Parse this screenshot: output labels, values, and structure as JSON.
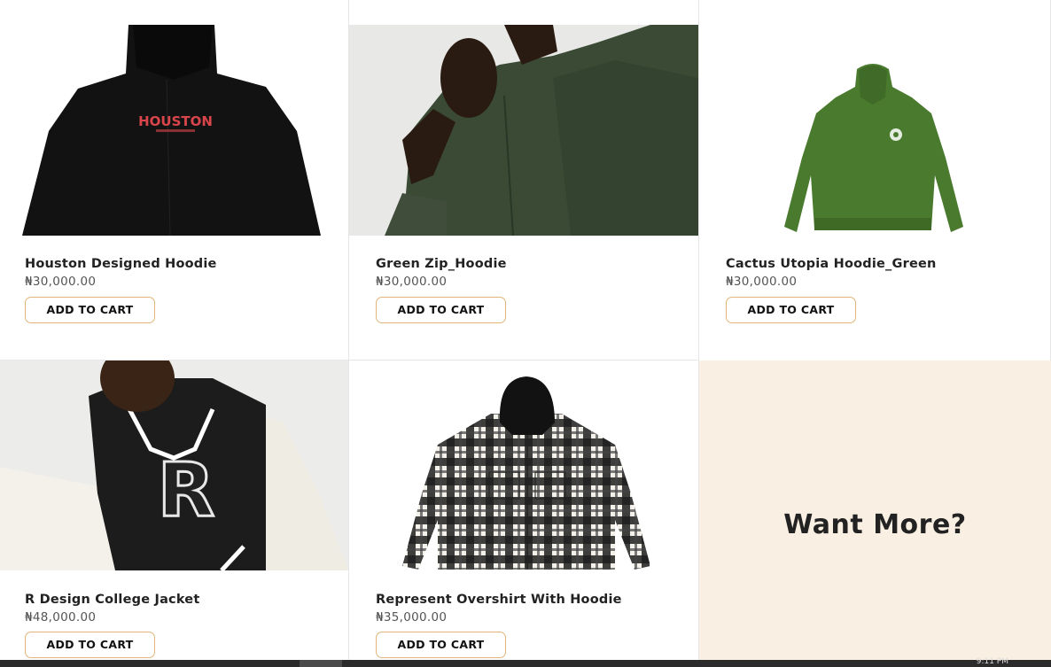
{
  "products": [
    {
      "name": "Houston Designed Hoodie",
      "price": "₦30,000.00",
      "button": "ADD TO CART",
      "print_text": "HOUSTON"
    },
    {
      "name": "Green Zip_Hoodie",
      "price": "₦30,000.00",
      "button": "ADD TO CART"
    },
    {
      "name": "Cactus Utopia Hoodie_Green",
      "price": "₦30,000.00",
      "button": "ADD TO CART"
    },
    {
      "name": "R Design College Jacket",
      "price": "₦48,000.00",
      "button": "ADD TO CART",
      "print_text": "R"
    },
    {
      "name": "Represent Overshirt With Hoodie",
      "price": "₦35,000.00",
      "button": "ADD TO CART"
    }
  ],
  "promo": {
    "title": "Want More?"
  },
  "taskbar": {
    "clock": "9:11 PM"
  },
  "colors": {
    "button_border": "#e2b67a",
    "promo_background": "#f9efe2",
    "divider": "#e6e6e6"
  }
}
